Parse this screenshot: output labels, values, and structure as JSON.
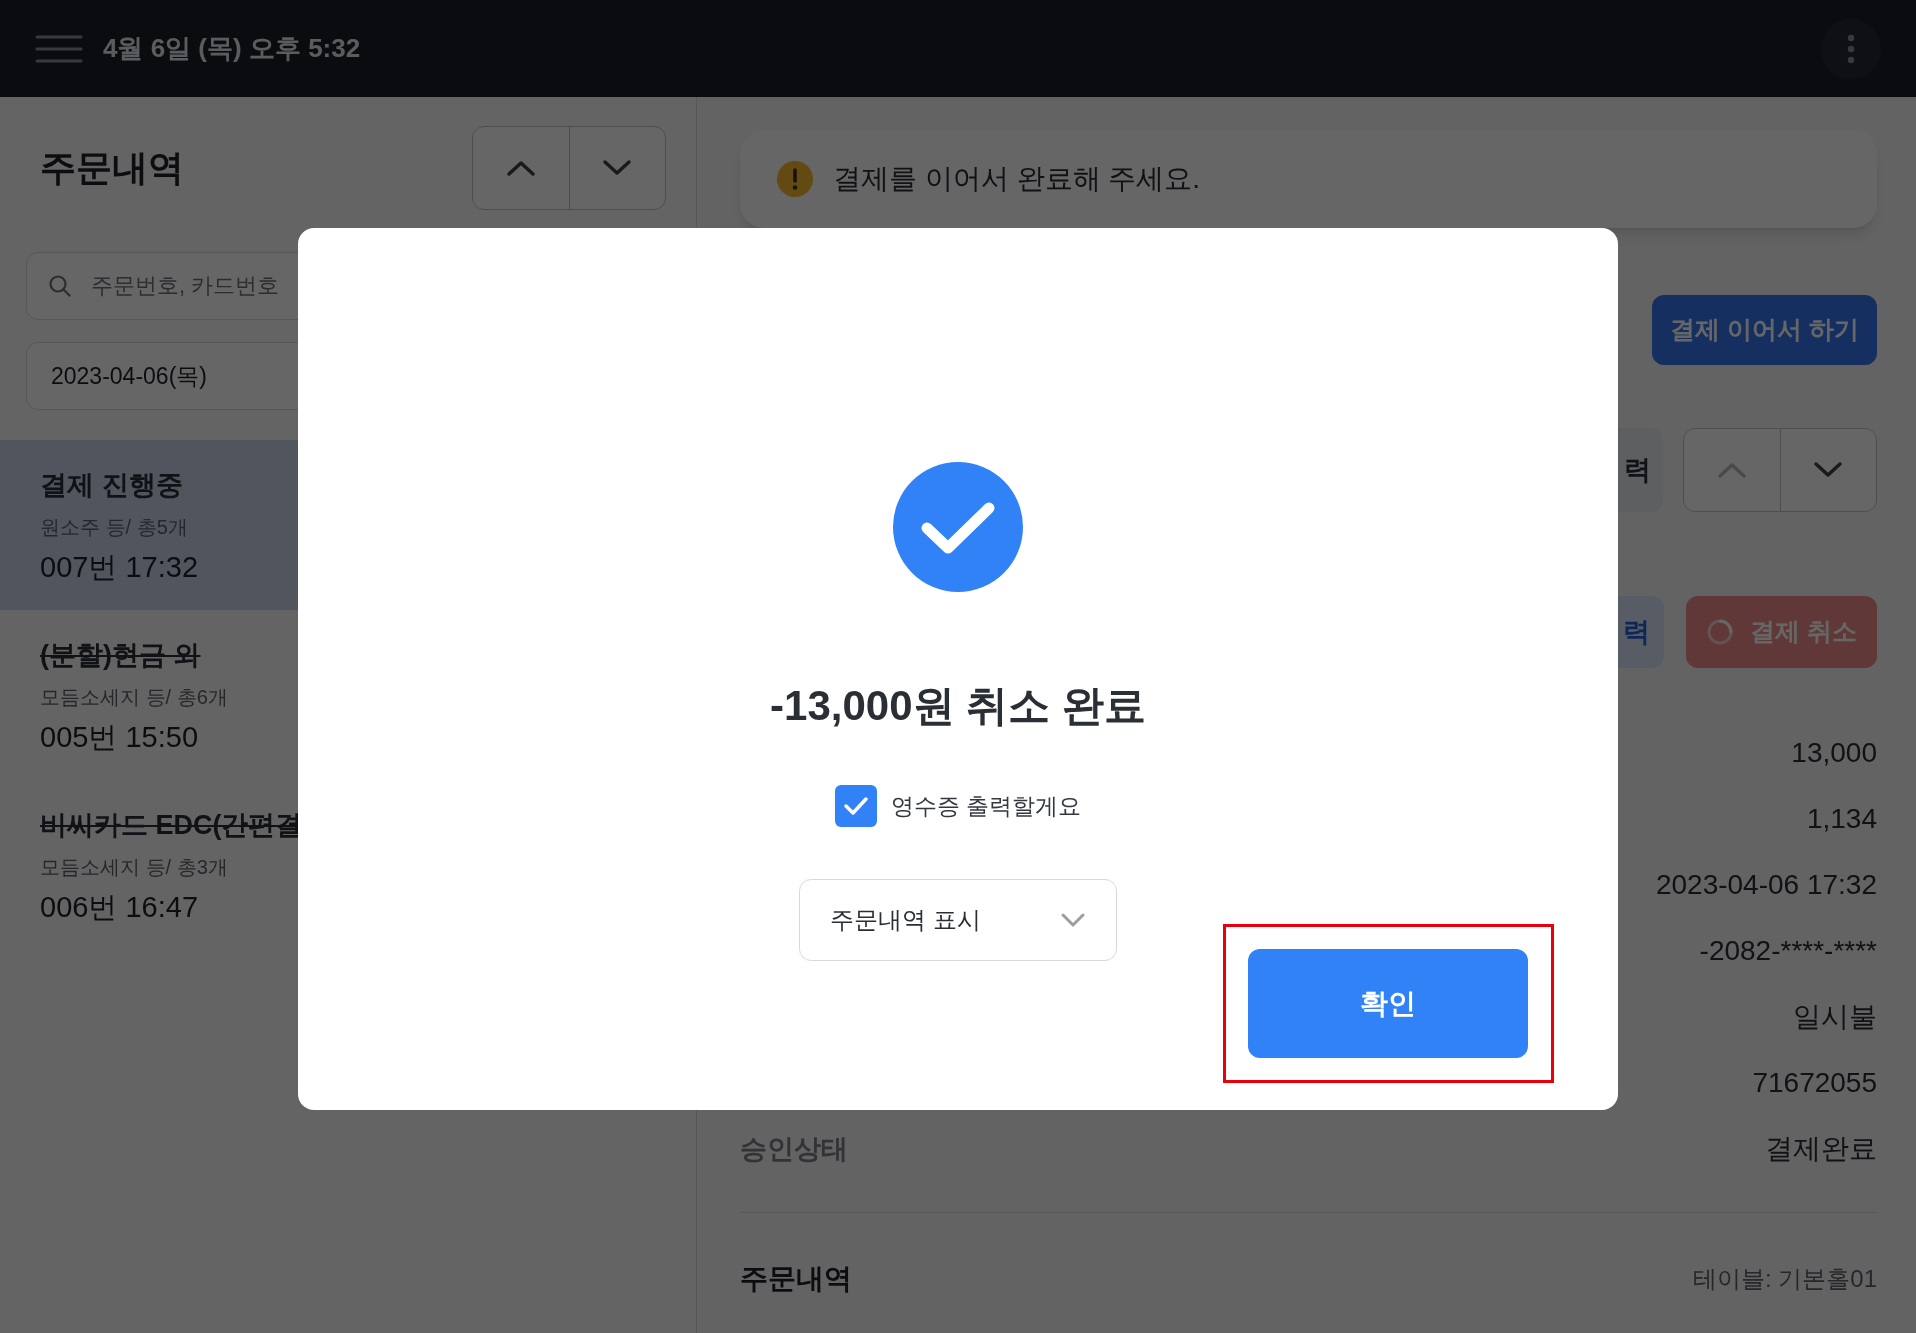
{
  "top_bar": {
    "datetime": "4월 6일 (목) 오후 5:32"
  },
  "order_list": {
    "title": "주문내역",
    "nav": {
      "up_disabled": false,
      "down_disabled": false
    },
    "search": {
      "placeholder": "주문번호, 카드번호"
    },
    "date": "2023-04-06(목)",
    "items": [
      {
        "title": "결제 진행중",
        "summary": "원소주 등/ 총5개",
        "number_time": "007번 17:32",
        "selected": true,
        "cancelled": false
      },
      {
        "title": "(분할)현금 외",
        "summary": "모듬소세지 등/ 총6개",
        "number_time": "005번 15:50",
        "selected": false,
        "cancelled": true
      },
      {
        "title": "비씨카드 EDC(간편결",
        "summary": "모듬소세지 등/ 총3개",
        "number_time": "006번 16:47",
        "selected": false,
        "cancelled": true
      }
    ]
  },
  "detail": {
    "notice": "결제를 이어서 완료해 주세요.",
    "continue_button": "결제 이어서 하기",
    "chip_1": "력",
    "nav": {
      "up_disabled": true,
      "down_disabled": false
    },
    "chip_2": "력",
    "cancel_button": {
      "label": "결제 취소",
      "loading": true
    },
    "values": [
      "13,000",
      "1,134",
      "2023-04-06 17:32",
      "-2082-****-****",
      "일시불",
      "71672055"
    ],
    "status_row": {
      "label": "승인상태",
      "value": "결제완료"
    },
    "section": {
      "title": "주문내역",
      "table": "테이블: 기본홀01"
    }
  },
  "dialog": {
    "title": "-13,000원 취소 완료",
    "receipt": {
      "label": "영수증 출력할게요",
      "checked": true
    },
    "display_select": {
      "value": "주문내역 표시"
    },
    "confirm_button": {
      "label": "확인",
      "highlighted": true
    }
  }
}
